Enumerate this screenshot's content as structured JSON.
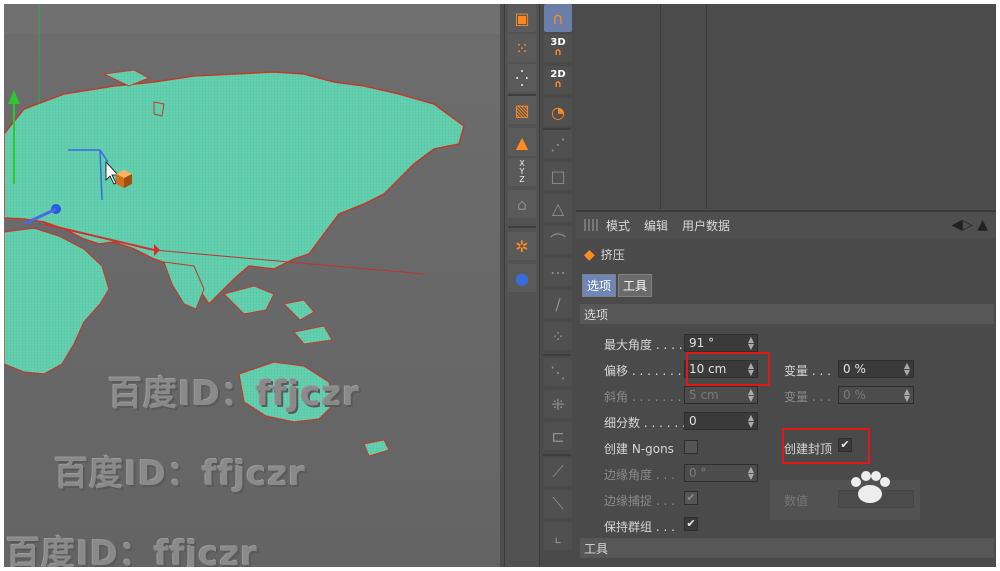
{
  "watermark": {
    "text": "百度ID：ffjczr"
  },
  "toolbar_labels": {
    "t3d": "3D",
    "t2d": "2D",
    "xyz_x": "X",
    "xyz_y": "Y",
    "xyz_z": "Z"
  },
  "attr_menu": {
    "mode": "模式",
    "edit": "编辑",
    "userdata": "用户数据"
  },
  "object_name": "挤压",
  "tabs": [
    {
      "label": "选项",
      "active": true
    },
    {
      "label": "工具",
      "active": false
    }
  ],
  "section_options": "选项",
  "section_tools": "工具",
  "fields": {
    "max_angle": {
      "label": "最大角度 . . . .",
      "value": "91 °"
    },
    "offset": {
      "label": "偏移 . . . . . . . . .",
      "value": "10 cm"
    },
    "variation": {
      "label": "变量 . . .",
      "value": "0 %"
    },
    "bevel": {
      "label": "斜角 . . . . . . . . .",
      "value": "5 cm"
    },
    "variation2": {
      "label": "变量 . . .",
      "value": "0 %"
    },
    "subdivision": {
      "label": "细分数 . . . . . .",
      "value": "0"
    },
    "create_ngons": {
      "label": "创建 N-gons",
      "checked": false
    },
    "create_caps": {
      "label": "创建封顶",
      "checked": true
    },
    "edge_angle": {
      "label": "边缘角度 . . .",
      "value": "0 °"
    },
    "edge_snap": {
      "label": "边缘捕捉 . . .",
      "checked": true
    },
    "keep_groups": {
      "label": "保持群组 . . .",
      "checked": true
    }
  },
  "partial": {
    "numeric": "数值"
  },
  "colors": {
    "map_fill": "#63d1b0",
    "highlight": "#e01818",
    "accent": "#ff8a20"
  }
}
